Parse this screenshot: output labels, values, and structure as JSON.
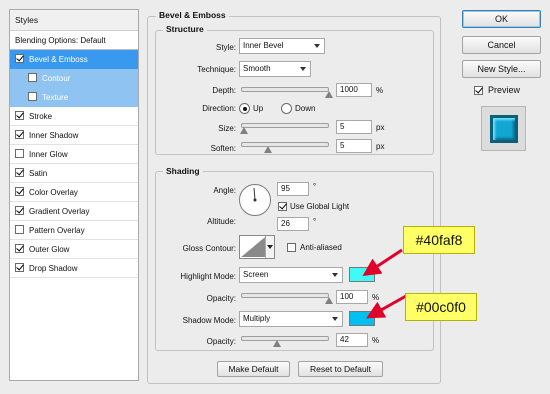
{
  "styles_panel": {
    "header": "Styles",
    "items": [
      {
        "label": "Blending Options: Default",
        "checkbox": false,
        "checked": false,
        "state": "normal"
      },
      {
        "label": "Bevel & Emboss",
        "checkbox": true,
        "checked": true,
        "state": "selected"
      },
      {
        "label": "Contour",
        "checkbox": true,
        "checked": false,
        "state": "sub"
      },
      {
        "label": "Texture",
        "checkbox": true,
        "checked": false,
        "state": "sub"
      },
      {
        "label": "Stroke",
        "checkbox": true,
        "checked": true,
        "state": "normal"
      },
      {
        "label": "Inner Shadow",
        "checkbox": true,
        "checked": true,
        "state": "normal"
      },
      {
        "label": "Inner Glow",
        "checkbox": true,
        "checked": false,
        "state": "normal"
      },
      {
        "label": "Satin",
        "checkbox": true,
        "checked": true,
        "state": "normal"
      },
      {
        "label": "Color Overlay",
        "checkbox": true,
        "checked": true,
        "state": "normal"
      },
      {
        "label": "Gradient Overlay",
        "checkbox": true,
        "checked": true,
        "state": "normal"
      },
      {
        "label": "Pattern Overlay",
        "checkbox": true,
        "checked": false,
        "state": "normal"
      },
      {
        "label": "Outer Glow",
        "checkbox": true,
        "checked": true,
        "state": "normal"
      },
      {
        "label": "Drop Shadow",
        "checkbox": true,
        "checked": true,
        "state": "normal"
      }
    ]
  },
  "bevel": {
    "section_title": "Bevel & Emboss",
    "structure": {
      "title": "Structure",
      "style_label": "Style:",
      "style_value": "Inner Bevel",
      "technique_label": "Technique:",
      "technique_value": "Smooth",
      "depth_label": "Depth:",
      "depth_value": "1000",
      "depth_unit": "%",
      "depth_slider": 1.0,
      "direction_label": "Direction:",
      "direction_up": "Up",
      "direction_down": "Down",
      "direction_selected": "Up",
      "size_label": "Size:",
      "size_value": "5",
      "size_unit": "px",
      "size_slider": 0.02,
      "soften_label": "Soften:",
      "soften_value": "5",
      "soften_unit": "px",
      "soften_slider": 0.3
    },
    "shading": {
      "title": "Shading",
      "angle_label": "Angle:",
      "angle_value": "95",
      "angle_unit": "°",
      "global_light_label": "Use Global Light",
      "global_light_checked": true,
      "altitude_label": "Altitude:",
      "altitude_value": "26",
      "altitude_unit": "°",
      "gloss_label": "Gloss Contour:",
      "anti_aliased_label": "Anti-aliased",
      "anti_aliased_checked": false,
      "highlight_mode_label": "Highlight Mode:",
      "highlight_mode_value": "Screen",
      "highlight_color": "#40faf8",
      "highlight_opacity_label": "Opacity:",
      "highlight_opacity_value": "100",
      "highlight_opacity_unit": "%",
      "highlight_opacity_slider": 1.0,
      "shadow_mode_label": "Shadow Mode:",
      "shadow_mode_value": "Multiply",
      "shadow_color": "#00c0f0",
      "shadow_opacity_label": "Opacity:",
      "shadow_opacity_value": "42",
      "shadow_opacity_unit": "%",
      "shadow_opacity_slider": 0.42
    },
    "make_default_label": "Make Default",
    "reset_default_label": "Reset to Default"
  },
  "buttons": {
    "ok": "OK",
    "cancel": "Cancel",
    "new_style": "New Style...",
    "preview_label": "Preview",
    "preview_checked": true
  },
  "annotations": {
    "highlight_callout": "#40faf8",
    "shadow_callout": "#00c0f0"
  },
  "colors": {
    "selection": "#3899ee",
    "sub_selection": "#8fc3f2",
    "callout_fill": "#ffff66",
    "arrow": "#e0002a",
    "preview_fill": "#12a7d3"
  }
}
